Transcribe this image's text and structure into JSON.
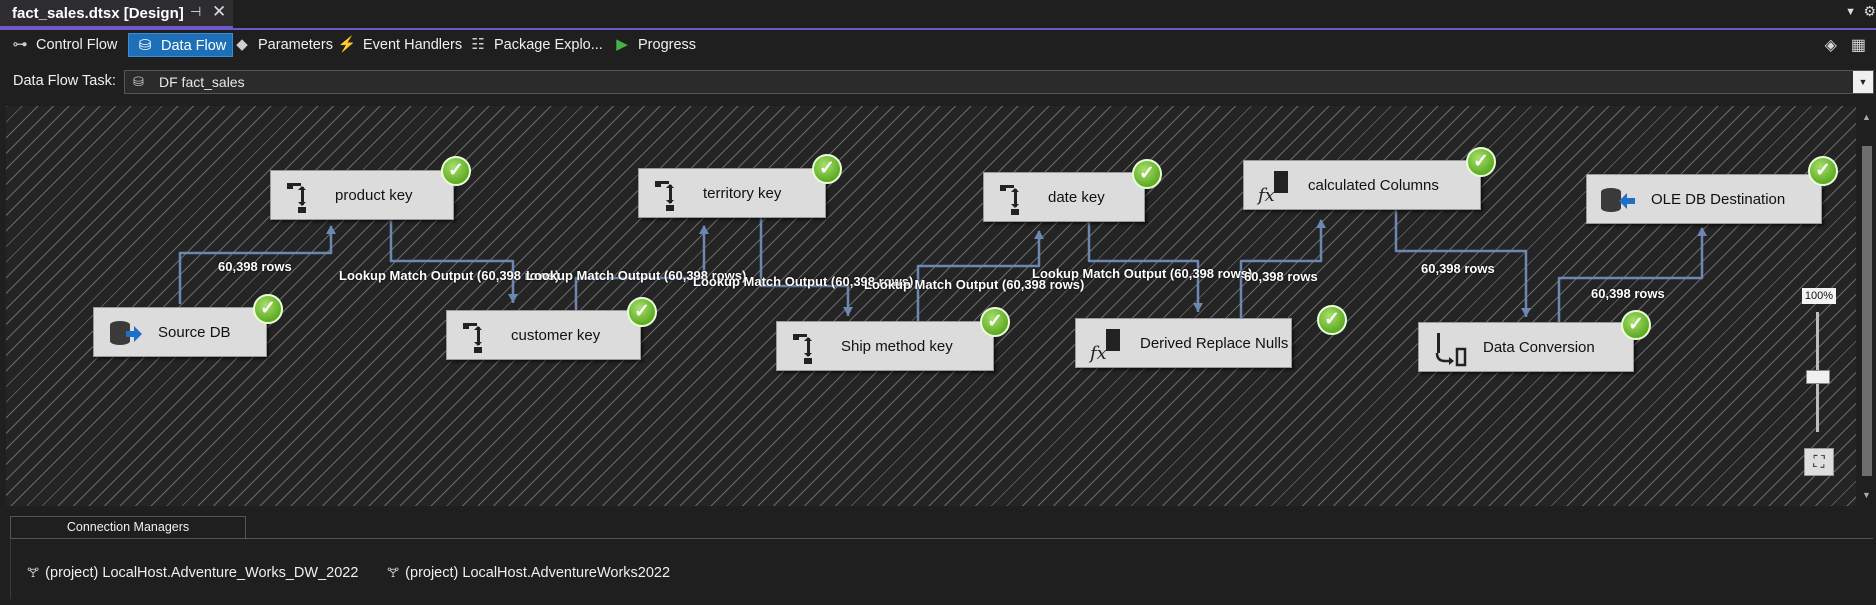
{
  "window": {
    "tab_title": "fact_sales.dtsx [Design]",
    "pin_glyph": "⊣",
    "close_glyph": "✕"
  },
  "designer_tabs": [
    {
      "label": "Control Flow",
      "icon": "control-flow-icon",
      "active": false
    },
    {
      "label": "Data Flow",
      "icon": "data-flow-icon",
      "active": true
    },
    {
      "label": "Parameters",
      "icon": "parameters-icon",
      "active": false
    },
    {
      "label": "Event Handlers",
      "icon": "event-handlers-icon",
      "active": false
    },
    {
      "label": "Package Explo...",
      "icon": "package-explorer-icon",
      "active": false
    },
    {
      "label": "Progress",
      "icon": "progress-play-icon",
      "active": false
    }
  ],
  "task": {
    "label": "Data Flow Task:",
    "value": "DF fact_sales"
  },
  "components": [
    {
      "id": "source-db",
      "name": "Source DB",
      "icon": "ole-db-source-icon",
      "status": "success"
    },
    {
      "id": "product-key",
      "name": "product key",
      "icon": "lookup-icon",
      "status": "success"
    },
    {
      "id": "customer-key",
      "name": "customer key",
      "icon": "lookup-icon",
      "status": "success"
    },
    {
      "id": "territory-key",
      "name": "territory key",
      "icon": "lookup-icon",
      "status": "success"
    },
    {
      "id": "ship-method-key",
      "name": "Ship method key",
      "icon": "lookup-icon",
      "status": "success"
    },
    {
      "id": "date-key",
      "name": "date key",
      "icon": "lookup-icon",
      "status": "success"
    },
    {
      "id": "derived-replace-nulls",
      "name": "Derived Replace Nulls",
      "icon": "derived-column-icon",
      "status": "success"
    },
    {
      "id": "calculated-columns",
      "name": "calculated Columns",
      "icon": "derived-column-icon",
      "status": "success"
    },
    {
      "id": "data-conversion",
      "name": "Data Conversion",
      "icon": "data-conversion-icon",
      "status": "success"
    },
    {
      "id": "ole-db-destination",
      "name": "OLE DB Destination",
      "icon": "ole-db-destination-icon",
      "status": "success"
    }
  ],
  "path_labels": [
    "60,398 rows",
    "Lookup Match Output (60,398 rows)",
    "Lookup Match Output (60,398 rows)",
    "Lookup Match Output (60,398 rows)",
    "Lookup Match Output (60,398 rows)",
    "Lookup Match Output (60,398 rows)",
    "60,398 rows",
    "60,398 rows",
    "60,398 rows"
  ],
  "zoom": {
    "label": "100%",
    "value": 1.0
  },
  "connection_managers": {
    "tab_label": "Connection Managers",
    "items": [
      "(project) LocalHost.Adventure_Works_DW_2022",
      "(project) LocalHost.AdventureWorks2022"
    ]
  },
  "colors": {
    "accent": "#6f56c9",
    "active_tab": "#1d6fb8",
    "wire": "#6d88b0",
    "success": "#5fab24"
  }
}
